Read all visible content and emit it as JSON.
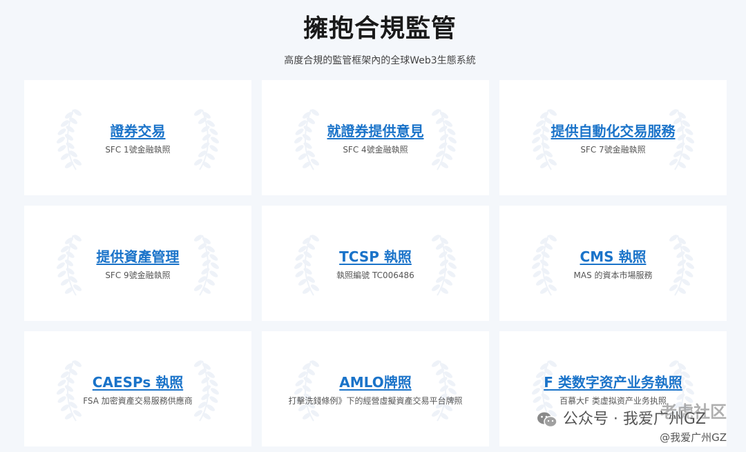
{
  "header": {
    "title": "擁抱合規監管",
    "subtitle": "高度合規的監管框架內的全球Web3生態系統"
  },
  "cards": [
    {
      "title": "證券交易",
      "subtitle": "SFC 1號金融執照"
    },
    {
      "title": "就證券提供意見",
      "subtitle": "SFC 4號金融執照"
    },
    {
      "title": "提供自動化交易服務",
      "subtitle": "SFC 7號金融執照"
    },
    {
      "title": "提供資產管理",
      "subtitle": "SFC 9號金融執照"
    },
    {
      "title": "TCSP 執照",
      "subtitle": "執照編號 TC006486"
    },
    {
      "title": "CMS 執照",
      "subtitle": "MAS 的資本市場服務"
    },
    {
      "title": "CAESPs 執照",
      "subtitle": "FSA 加密資產交易服務供應商"
    },
    {
      "title": "AMLO牌照",
      "subtitle": "打擊洗錢條例》下的經營虛擬資產交易平台牌照"
    },
    {
      "title": "F 类数字资产业务執照",
      "subtitle": "百慕大F 类虚拟资产业务执照"
    }
  ],
  "watermark": {
    "channel": "公众号 · 我爱广州GZ",
    "community": "老虎社区",
    "handle": "@我爱广州GZ",
    "icon": "wechat-icon"
  },
  "colors": {
    "link": "#1a73c9",
    "background": "#f4f7fb",
    "card": "#ffffff",
    "wreath": "#eef2f8"
  }
}
